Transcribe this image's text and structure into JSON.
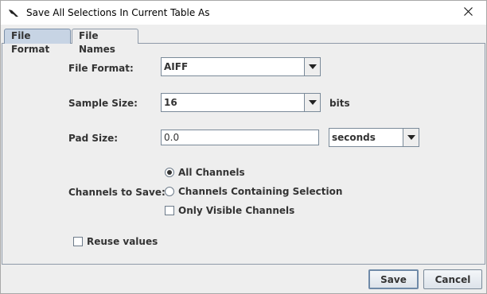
{
  "window": {
    "title": "Save All Selections In Current Table As",
    "app_icon": "bird-icon",
    "close_icon": "close-icon"
  },
  "tabs": [
    {
      "label": "File Format",
      "active": true
    },
    {
      "label": "File Names",
      "active": false
    }
  ],
  "form": {
    "file_format": {
      "label": "File Format:",
      "value": "AIFF"
    },
    "sample_size": {
      "label": "Sample Size:",
      "value": "16",
      "unit": "bits"
    },
    "pad_size": {
      "label": "Pad Size:",
      "value": "0.0",
      "unit": "seconds"
    },
    "channels": {
      "label": "Channels to Save:",
      "options": [
        {
          "label": "All Channels",
          "selected": true
        },
        {
          "label": "Channels Containing Selection",
          "selected": false
        }
      ],
      "only_visible": {
        "label": "Only Visible Channels",
        "checked": false
      }
    },
    "reuse_values": {
      "label": "Reuse values",
      "checked": false
    }
  },
  "buttons": {
    "save": "Save",
    "cancel": "Cancel"
  },
  "colors": {
    "active_tab": "#c7d4e4",
    "panel_bg": "#eeeeee",
    "border": "#7a8a99"
  }
}
